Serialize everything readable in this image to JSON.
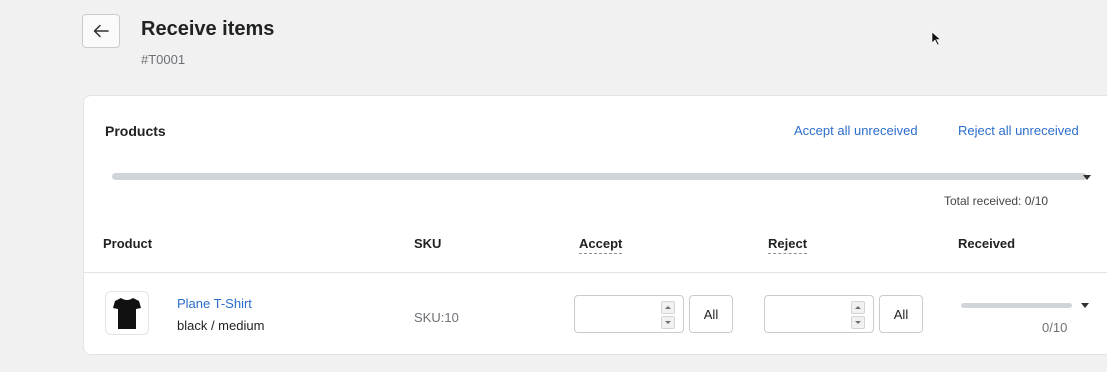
{
  "header": {
    "title": "Receive items",
    "subtitle": "#T0001"
  },
  "icons": {
    "back": "arrow-left-icon",
    "product_thumbnail": "t-shirt-icon",
    "cursor": "mouse-pointer-icon"
  },
  "products_card": {
    "title": "Products",
    "accept_all_label": "Accept all unreceived",
    "reject_all_label": "Reject all unreceived",
    "total_received_label": "Total received: 0/10",
    "total_received_fraction": 0,
    "columns": [
      "Product",
      "SKU",
      "Accept",
      "Reject",
      "Received"
    ],
    "rows": [
      {
        "name": "Plane T-Shirt",
        "variant": "black / medium",
        "sku": "SKU:10",
        "accept_value": "",
        "accept_all_label": "All",
        "reject_value": "",
        "reject_all_label": "All",
        "received_label": "0/10",
        "received_fraction": 0
      }
    ]
  },
  "colors": {
    "link": "#2c6ecb",
    "background": "#f1f1f1",
    "card": "#ffffff",
    "progress_track": "#d2d5d8"
  }
}
